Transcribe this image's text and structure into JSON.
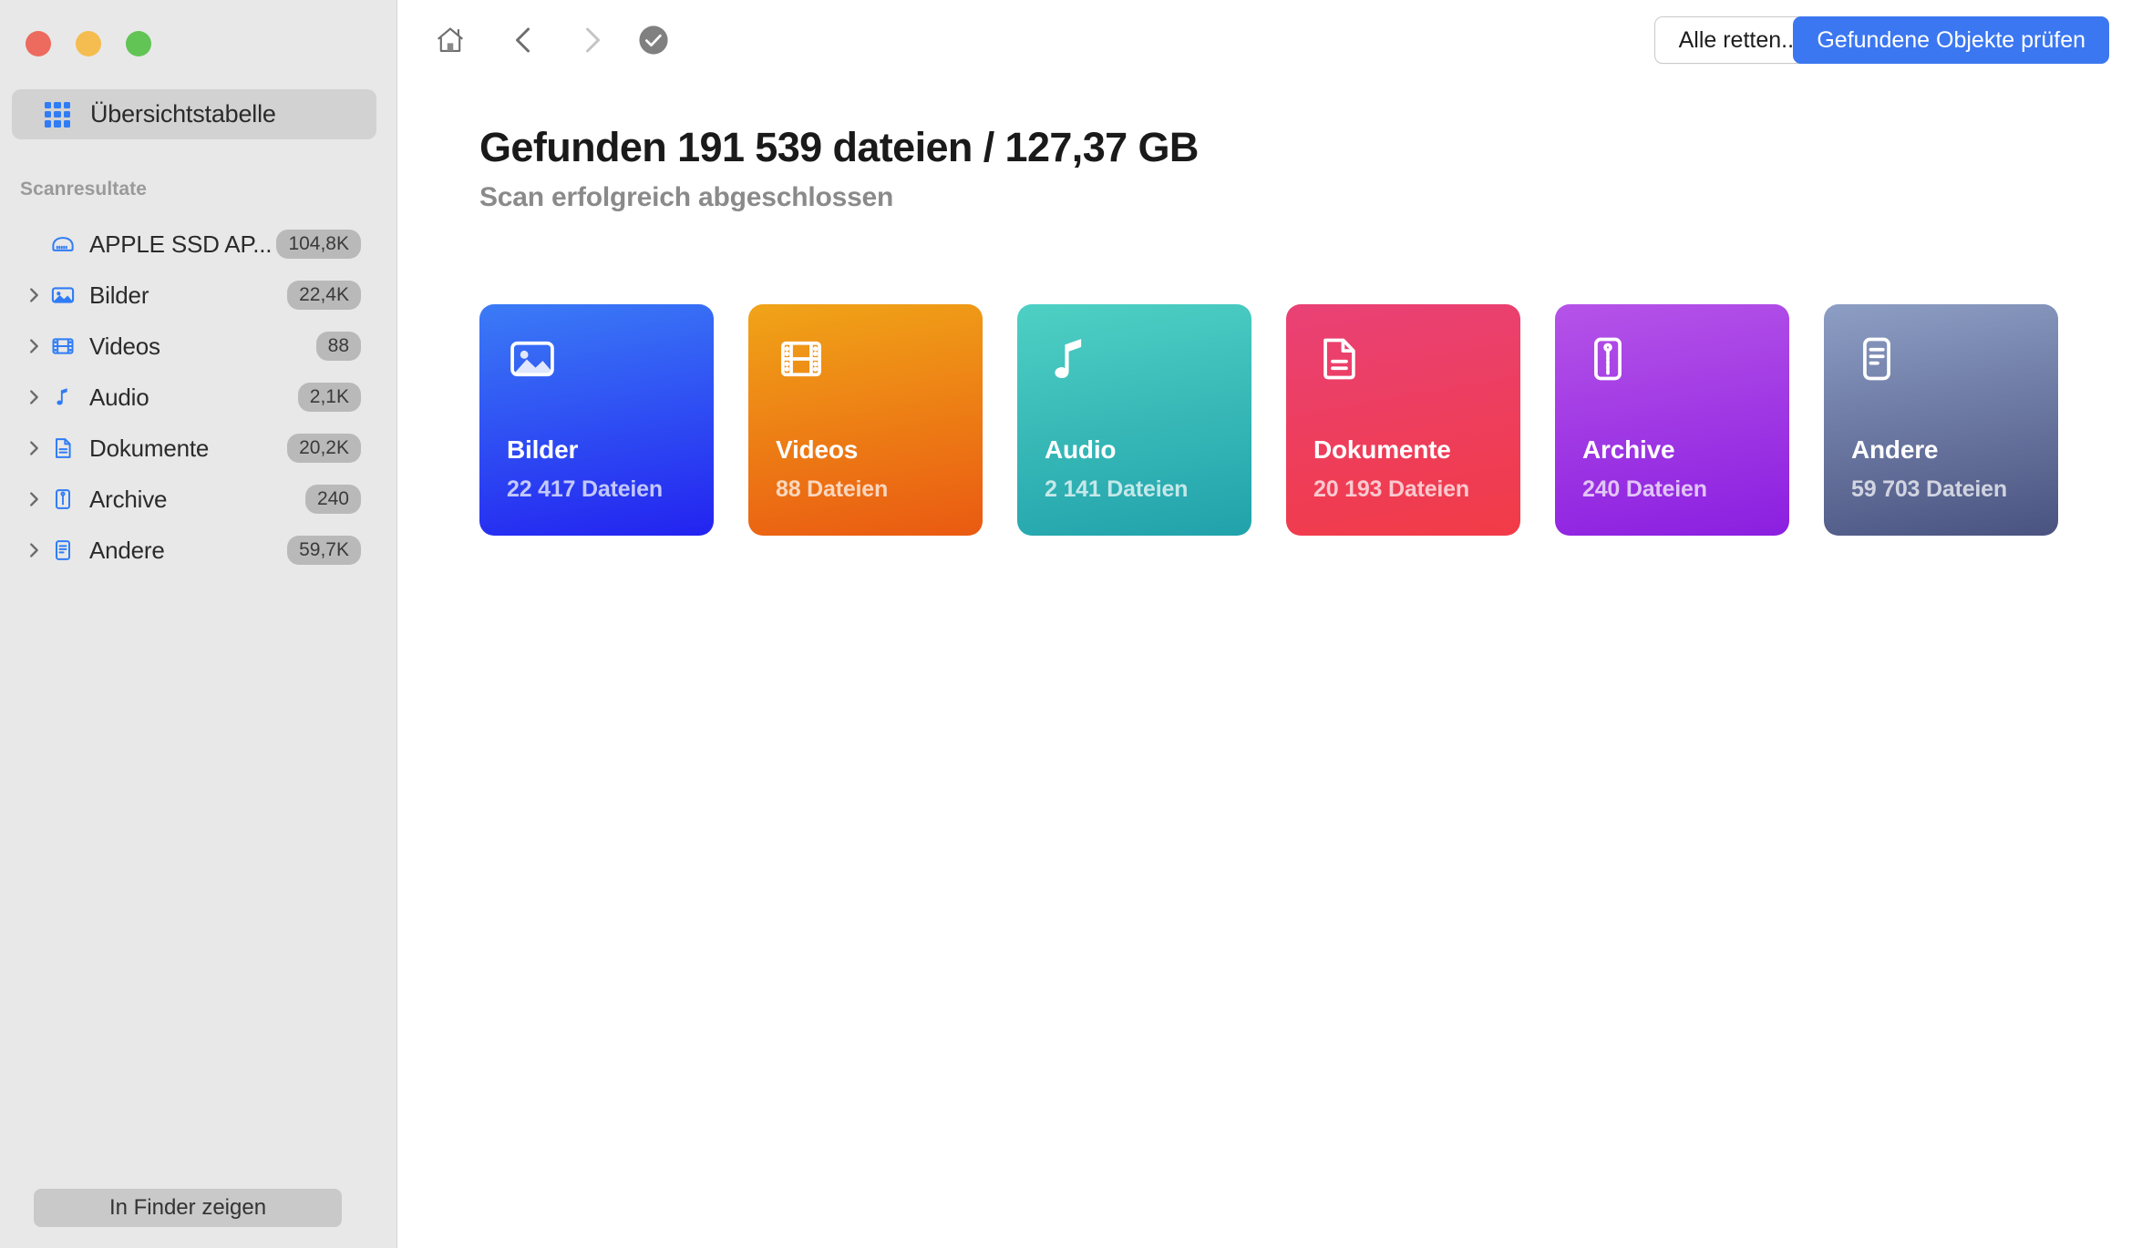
{
  "window": {
    "traffic_lights": [
      {
        "name": "close",
        "color": "#ed6a5e"
      },
      {
        "name": "minimize",
        "color": "#f5bd4f"
      },
      {
        "name": "zoom",
        "color": "#61c454"
      }
    ]
  },
  "sidebar": {
    "overview_label": "Übersichtstabelle",
    "section_title": "Scanresultate",
    "finder_button": "In Finder zeigen",
    "items": [
      {
        "label": "APPLE SSD AP...",
        "badge": "104,8K",
        "icon": "disk-icon",
        "expandable": false
      },
      {
        "label": "Bilder",
        "badge": "22,4K",
        "icon": "image-icon",
        "expandable": true
      },
      {
        "label": "Videos",
        "badge": "88",
        "icon": "film-icon",
        "expandable": true
      },
      {
        "label": "Audio",
        "badge": "2,1K",
        "icon": "music-icon",
        "expandable": true
      },
      {
        "label": "Dokumente",
        "badge": "20,2K",
        "icon": "document-icon",
        "expandable": true
      },
      {
        "label": "Archive",
        "badge": "240",
        "icon": "archive-icon",
        "expandable": true
      },
      {
        "label": "Andere",
        "badge": "59,7K",
        "icon": "other-icon",
        "expandable": true
      }
    ]
  },
  "toolbar": {
    "home_icon": "home-icon",
    "back_icon": "chevron-left-icon",
    "forward_icon": "chevron-right-icon",
    "status_icon": "check-circle-icon",
    "rescue_label": "Alle retten...",
    "review_label": "Gefundene Objekte prüfen",
    "accent_color": "#3b77f0"
  },
  "main": {
    "headline": "Gefunden 191 539 dateien / 127,37 GB",
    "subhead": "Scan erfolgreich abgeschlossen",
    "cards": [
      {
        "title": "Bilder",
        "count": "22 417 Dateien",
        "icon": "image-icon",
        "from": "#3b7bf6",
        "to": "#2323f0"
      },
      {
        "title": "Videos",
        "count": "88 Dateien",
        "icon": "film-icon",
        "from": "#f0a418",
        "to": "#ea5a12"
      },
      {
        "title": "Audio",
        "count": "2 141 Dateien",
        "icon": "music-icon",
        "from": "#4fd0c4",
        "to": "#21a2ab"
      },
      {
        "title": "Dokumente",
        "count": "20 193 Dateien",
        "icon": "document-icon",
        "from": "#e94176",
        "to": "#f23b47"
      },
      {
        "title": "Archive",
        "count": "240 Dateien",
        "icon": "archive-icon",
        "from": "#b553e8",
        "to": "#8b1fe0"
      },
      {
        "title": "Andere",
        "count": "59 703 Dateien",
        "icon": "other-icon",
        "from": "#8d9ec4",
        "to": "#4a5380"
      }
    ]
  }
}
